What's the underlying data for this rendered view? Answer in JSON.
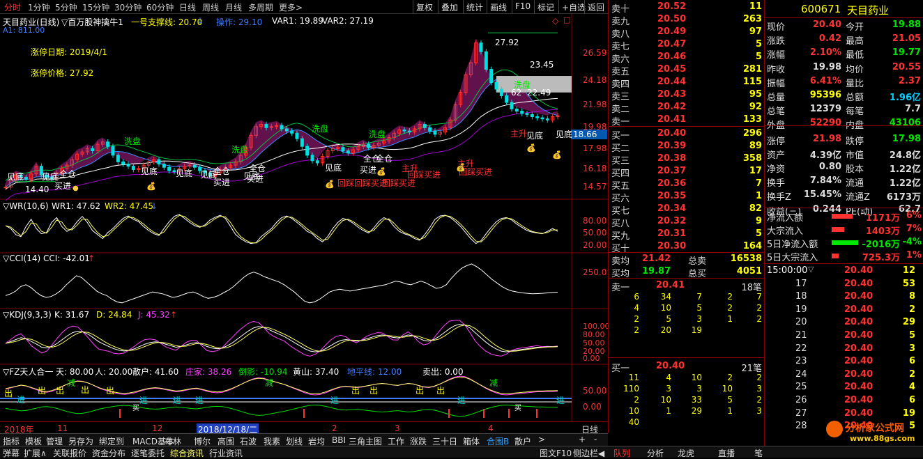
{
  "toolbar": {
    "periods": [
      "分时",
      "1分钟",
      "5分钟",
      "15分钟",
      "30分钟",
      "60分钟",
      "日线",
      "周线",
      "月线",
      "多周期",
      "更多>"
    ],
    "buttons": [
      "复权",
      "叠加",
      "统计",
      "画线",
      "F10",
      "标记",
      "+自选",
      "返回"
    ]
  },
  "main_chart": {
    "title": "天目药业(日线)",
    "indicator": "百万股神擒牛1",
    "support_label": "一号支撑线: 20.70",
    "operate_label": "操作: 29.10",
    "var1_label": "VAR1: 19.89",
    "var2_label": "VAR2: 27.19",
    "a1_label": "A1: 811.00",
    "limit_date": "涨停日期: 2019/4/1",
    "limit_price": "涨停价格: 27.92",
    "y_ticks": [
      "26.59",
      "24.18",
      "21.98",
      "19.98",
      "17.98",
      "16.18",
      "14.57"
    ],
    "current_price_tag": "18.66",
    "annotations": {
      "peak": "27.92",
      "box_top": "23.45",
      "box_bottom": "22.49",
      "box_left": "62",
      "low": "14.40",
      "wash": "洗盘",
      "bottom": "见底",
      "buy": "买进",
      "full": "全仓",
      "rise": "主升",
      "pullback_buy": "回踩买进",
      "pullback_buy_dup": "回踩回踩买进"
    },
    "candles": [
      13.9,
      14.6,
      15.0,
      14.8,
      14.6,
      15.1,
      15.8,
      15.0,
      14.8,
      14.7,
      15.2,
      15.6,
      15.9,
      16.4,
      16.9,
      17.1,
      17.4,
      17.2,
      17.8,
      18.0,
      17.6,
      16.8,
      16.2,
      16.0,
      15.8,
      15.5,
      15.6,
      15.9,
      16.2,
      16.4,
      16.0,
      15.7,
      15.4,
      15.3,
      15.6,
      15.8,
      15.9,
      15.7,
      15.4,
      15.2,
      14.9,
      15.2,
      15.5,
      15.7,
      15.9,
      16.2,
      16.8,
      17.5,
      18.6,
      19.4,
      19.6,
      19.3,
      19.4,
      19.5,
      19.2,
      19.0,
      18.8,
      18.3,
      17.6,
      16.8,
      16.3,
      16.1,
      16.7,
      17.2,
      17.4,
      17.5,
      17.2,
      17.0,
      17.3,
      17.6,
      17.8,
      17.5,
      17.7,
      17.9,
      18.1,
      18.4,
      18.8,
      19.1,
      19.0,
      18.9,
      19.2,
      19.6,
      19.3,
      19.0,
      18.7,
      18.9,
      19.3,
      20.0,
      21.4,
      22.5,
      24.1,
      25.2,
      27.0,
      26.2,
      24.6,
      23.4,
      22.8,
      22.2,
      21.6,
      21.0,
      20.8,
      20.6,
      20.5,
      20.3,
      20.2,
      20.1,
      20.0,
      20.3,
      20.4
    ]
  },
  "wr_panel": {
    "title": "WR(10,6)",
    "wr1": "WR1: 47.62",
    "wr2": "WR2: 47.45",
    "ticks": [
      "80.00",
      "50.00",
      "20.00"
    ],
    "wr1_values": [
      62,
      55,
      40,
      35,
      60,
      78,
      55,
      42,
      45,
      70,
      82,
      60,
      48,
      55,
      72,
      85,
      70,
      50,
      40,
      30,
      45,
      55,
      68,
      80,
      86,
      78,
      72,
      60,
      50,
      42,
      38,
      55,
      72,
      85,
      90,
      80,
      70,
      62,
      58,
      64,
      76,
      83,
      88,
      80,
      60,
      40,
      30,
      22,
      18,
      20,
      35,
      45,
      55,
      70,
      82,
      86,
      80,
      70,
      60,
      48,
      42,
      30,
      22,
      35,
      55,
      70,
      80,
      76,
      68,
      58,
      50,
      44,
      56,
      72,
      82,
      76,
      60,
      48,
      42,
      38,
      30,
      26,
      40,
      58,
      78,
      86,
      88,
      82,
      72,
      60,
      45,
      30,
      18,
      25,
      42,
      58,
      72,
      80,
      82,
      76,
      66,
      58,
      50,
      46,
      44,
      42,
      48,
      55,
      48
    ]
  },
  "cci_panel": {
    "title": "CCI(14)",
    "cci": "CCI: -42.01",
    "ticks": [
      "250.0"
    ],
    "values": [
      -80,
      -60,
      -30,
      20,
      40,
      10,
      -40,
      -80,
      -100,
      -90,
      -60,
      -20,
      40,
      90,
      140,
      120,
      70,
      20,
      -30,
      -60,
      -80,
      -120,
      -150,
      -160,
      -140,
      -120,
      -100,
      -80,
      -60,
      -40,
      -50,
      -60,
      -80,
      -100,
      -90,
      -70,
      -50,
      -40,
      -60,
      -90,
      -110,
      -100,
      -80,
      -50,
      -20,
      20,
      70,
      120,
      160,
      180,
      160,
      130,
      110,
      90,
      70,
      40,
      0,
      -40,
      -90,
      -140,
      -160,
      -150,
      -120,
      -80,
      -40,
      -20,
      -10,
      -20,
      -30,
      -20,
      -10,
      0,
      10,
      20,
      30,
      40,
      60,
      80,
      70,
      50,
      40,
      60,
      80,
      60,
      30,
      0,
      10,
      40,
      110,
      170,
      220,
      250,
      270,
      240,
      200,
      150,
      100,
      60,
      20,
      -10,
      -30,
      -40,
      -50,
      -55,
      -60,
      -58,
      -55,
      -50,
      -45,
      -42
    ]
  },
  "kdj_panel": {
    "title": "KDJ(9,3,3)",
    "k": "K: 31.67",
    "d": "D: 24.84",
    "j": "J: 45.32",
    "ticks": [
      "100.00",
      "80.00",
      "50.00",
      "20.00",
      "0.00"
    ],
    "k_values": [
      40,
      45,
      50,
      55,
      52,
      45,
      38,
      30,
      28,
      32,
      40,
      50,
      60,
      68,
      72,
      70,
      64,
      55,
      45,
      38,
      32,
      26,
      22,
      20,
      22,
      26,
      32,
      38,
      42,
      44,
      42,
      38,
      34,
      30,
      32,
      36,
      40,
      42,
      38,
      32,
      28,
      26,
      28,
      34,
      42,
      52,
      62,
      72,
      80,
      84,
      82,
      76,
      70,
      64,
      58,
      50,
      42,
      34,
      26,
      20,
      18,
      20,
      26,
      34,
      42,
      48,
      50,
      48,
      46,
      48,
      52,
      56,
      60,
      62,
      60,
      56,
      54,
      58,
      62,
      60,
      54,
      48,
      46,
      50,
      58,
      68,
      78,
      86,
      90,
      88,
      80,
      68,
      56,
      44,
      34,
      26,
      20,
      18,
      20,
      22,
      24,
      26,
      28,
      30,
      30,
      31,
      31,
      32
    ]
  },
  "fz_panel": {
    "title": "FZ天人合一",
    "tian": "天: 80.00",
    "ren": "人: 20.00",
    "sanhu": "散户: 41.60",
    "zhuangjia": "庄家: 38.26",
    "daoying": "倒影: -10.94",
    "huangshan": "黄山: 37.40",
    "dipingxian": "地平线: 12.00",
    "maichu": "卖出: 0.00",
    "ticks": [
      "50.00",
      "0.00"
    ],
    "labels": {
      "out": "出",
      "in": "进",
      "reduce": "减",
      "buy_small": "买"
    }
  },
  "x_axis": {
    "labels": [
      "2018年",
      "11",
      "12",
      "2018/12/18/二",
      "2",
      "3",
      "4"
    ],
    "right_label": "日线"
  },
  "bottom_tabs": [
    "指标",
    "模板",
    "管理",
    "另存为",
    "绑定到",
    "MACD基本",
    "布林",
    "博尔",
    "高围",
    "石波",
    "我素",
    "划线",
    "岩均",
    "BBI",
    "三角主图",
    "工作",
    "涨跌",
    "三十日",
    "箱体",
    "合围B",
    "散户"
  ],
  "bottom_bar": {
    "left": [
      "弹幕",
      "扩展∧",
      "关联报价",
      "资金分布",
      "逐笔委托",
      "综合资讯",
      "行业资讯"
    ],
    "right": [
      "图文F10",
      "侧边栏◀",
      "队列",
      "分析",
      "龙虎",
      "直播",
      "笔"
    ]
  },
  "order_book": {
    "asks": [
      [
        "卖十",
        "20.52",
        "11"
      ],
      [
        "卖九",
        "20.50",
        "263"
      ],
      [
        "卖八",
        "20.49",
        "97"
      ],
      [
        "卖七",
        "20.47",
        "5"
      ],
      [
        "卖六",
        "20.46",
        "5"
      ],
      [
        "卖五",
        "20.45",
        "281"
      ],
      [
        "卖四",
        "20.44",
        "115"
      ],
      [
        "卖三",
        "20.43",
        "95"
      ],
      [
        "卖二",
        "20.42",
        "92"
      ],
      [
        "卖一",
        "20.41",
        "133"
      ]
    ],
    "bids": [
      [
        "买一",
        "20.40",
        "296"
      ],
      [
        "买二",
        "20.39",
        "89"
      ],
      [
        "买三",
        "20.38",
        "358"
      ],
      [
        "买四",
        "20.37",
        "17"
      ],
      [
        "买五",
        "20.36",
        "7"
      ],
      [
        "买六",
        "20.35",
        "1"
      ],
      [
        "买七",
        "20.34",
        "82"
      ],
      [
        "买八",
        "20.32",
        "9"
      ],
      [
        "买九",
        "20.31",
        "5"
      ],
      [
        "买十",
        "20.30",
        "164"
      ]
    ],
    "ask_avg": [
      "卖均",
      "21.42",
      "总卖",
      "16538"
    ],
    "bid_avg": [
      "买均",
      "19.87",
      "总买",
      "4051"
    ],
    "queue_ask": {
      "label": "卖一",
      "price": "20.41",
      "count": "18笔",
      "rows": [
        [
          "6",
          "34",
          "7",
          "2",
          "7"
        ],
        [
          "4",
          "10",
          "5",
          "2",
          "2"
        ],
        [
          "2",
          "5",
          "3",
          "1",
          "2"
        ],
        [
          "2",
          "20",
          "19",
          "",
          ""
        ]
      ]
    },
    "queue_bid": {
      "label": "买一",
      "price": "20.40",
      "count": "21笔",
      "rows": [
        [
          "11",
          "4",
          "10",
          "2",
          "2"
        ],
        [
          "110",
          "3",
          "3",
          "10",
          "3"
        ],
        [
          "2",
          "10",
          "33",
          "5",
          "2"
        ],
        [
          "10",
          "1",
          "29",
          "1",
          "3"
        ],
        [
          "40",
          "",
          "",
          "",
          ""
        ]
      ]
    }
  },
  "quote": {
    "code": "600671",
    "name": "天目药业",
    "rows": [
      [
        "现价",
        "20.40",
        "今开",
        "19.88"
      ],
      [
        "涨跌",
        "0.42",
        "最高",
        "21.05"
      ],
      [
        "涨幅",
        "2.10%",
        "最低",
        "19.77"
      ],
      [
        "昨收",
        "19.98",
        "均价",
        "20.55"
      ],
      [
        "振幅",
        "6.41%",
        "量比",
        "2.37"
      ],
      [
        "总量",
        "95396",
        "总额",
        "1.96亿"
      ],
      [
        "总笔",
        "12379",
        "每笔",
        "7.7"
      ],
      [
        "外盘",
        "52290",
        "内盘",
        "43106"
      ],
      [
        "涨停",
        "21.98",
        "跌停",
        "17.98"
      ],
      [
        "资产",
        "4.39亿",
        "市值",
        "24.8亿"
      ],
      [
        "净资",
        "0.80",
        "股本",
        "1.22亿"
      ],
      [
        "换手",
        "7.84%",
        "流通",
        "1.22亿"
      ],
      [
        "换手Z",
        "15.45%",
        "流通Z",
        "6173万"
      ],
      [
        "收益(三)",
        "0.244",
        "PE(动)",
        "62.7"
      ]
    ],
    "flows": [
      [
        "净流入额",
        "1171万",
        "6%"
      ],
      [
        "大宗流入",
        "1403万",
        "7%"
      ],
      [
        "5日净流入额",
        "-2016万",
        "-4%"
      ],
      [
        "5日大宗流入",
        "725.3万",
        "1%"
      ]
    ],
    "ticks_header": "15:00:00",
    "ticks": [
      [
        "",
        "20.40",
        "12"
      ],
      [
        "17",
        "20.40",
        "53"
      ],
      [
        "18",
        "20.40",
        "8"
      ],
      [
        "19",
        "20.40",
        "2"
      ],
      [
        "20",
        "20.40",
        "29"
      ],
      [
        "21",
        "20.40",
        "5"
      ],
      [
        "22",
        "20.40",
        "3"
      ],
      [
        "23",
        "20.40",
        "6"
      ],
      [
        "24",
        "20.40",
        "2"
      ],
      [
        "25",
        "20.40",
        "4"
      ],
      [
        "26",
        "20.40",
        "6"
      ],
      [
        "27",
        "20.40",
        "19"
      ],
      [
        "28",
        "20.40",
        "5"
      ]
    ],
    "watermark_title": "分析家公式网",
    "watermark_url": "www.88gs.com"
  },
  "colors": {
    "up": "#ff3232",
    "down": "#00e0e0",
    "accent": "#ffff00",
    "grid": "#800000"
  }
}
